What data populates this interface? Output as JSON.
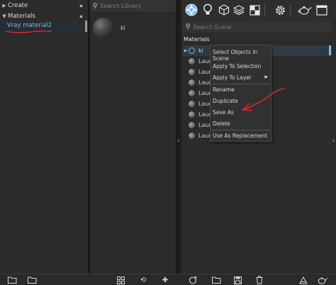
{
  "left_panel": {
    "items": [
      {
        "label": "Create",
        "locked": true
      },
      {
        "label": "Materials",
        "locked": true
      }
    ],
    "selected_item": "Vray material2"
  },
  "library_panel": {
    "search_placeholder": "Search Library",
    "items": [
      {
        "label": "ki"
      }
    ]
  },
  "scene_panel": {
    "toolbar_icons": [
      "material-sphere-icon",
      "lightbulb-icon",
      "cube-icon",
      "layers-icon",
      "texture-icon",
      "gear-icon",
      "teapot-icon",
      "window-icon"
    ],
    "search_placeholder": "Search Scene",
    "header": "Materials",
    "rows": [
      {
        "label": "ki"
      },
      {
        "label": "Laura"
      },
      {
        "label": "Laura"
      },
      {
        "label": "Laura"
      },
      {
        "label": "Laura"
      },
      {
        "label": "Laura"
      },
      {
        "label": "Laura"
      },
      {
        "label": "Laura"
      },
      {
        "label": "Laura"
      }
    ]
  },
  "context_menu": {
    "items": [
      "Select Objects In Scene",
      "Apply To Selection",
      "Apply To Layer",
      "Rename",
      "Duplicate",
      "Save As",
      "Delete",
      "Use As Replacement"
    ],
    "submenu_item": "Apply To Layer",
    "highlighted_item": "Save As"
  },
  "bottom_bar": {
    "icons": [
      "open-folder-icon",
      "open-folder-icon",
      "grid-view-icon",
      "refresh-icon",
      "add-icon",
      "add-material-icon",
      "open-folder-icon",
      "save-icon",
      "delete-icon",
      "purge-icon",
      "teapot-icon"
    ]
  },
  "colors": {
    "panel_bg": "#2b2b2b",
    "accent_blue": "#7db9e8",
    "annotation_red": "#e0262b"
  }
}
